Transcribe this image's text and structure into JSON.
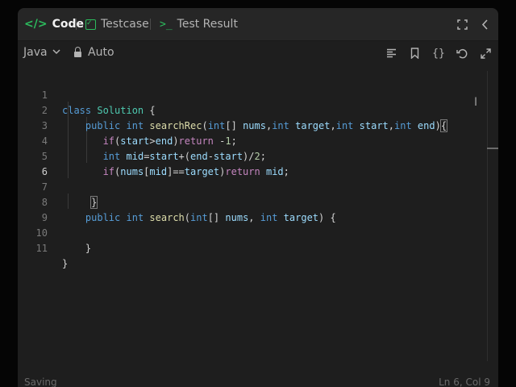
{
  "tabs": {
    "code": "Code",
    "testcase": "Testcase",
    "test_result": "Test Result"
  },
  "toolbar": {
    "language": "Java",
    "mode": "Auto"
  },
  "editor": {
    "line_numbers": [
      "1",
      "2",
      "3",
      "4",
      "5",
      "6",
      "7",
      "8",
      "9",
      "10",
      "11"
    ],
    "active_line": "6"
  },
  "status": {
    "left": "Saving",
    "right": "Ln 6, Col 9"
  },
  "icons": {
    "code_tab": "code-brackets-icon",
    "testcase_tab": "checkbox-icon",
    "result_tab": "terminal-icon",
    "fullscreen": "expand-icon",
    "collapse": "chevron-left-icon",
    "format": "align-left-icon",
    "bookmark": "bookmark-icon",
    "braces": "braces-icon",
    "reset": "undo-icon",
    "expand": "diagonal-expand-icon"
  },
  "colors": {
    "accent": "#2cbb5d",
    "keyword": "#569cd6",
    "control": "#c586c0",
    "function": "#dcdcaa",
    "class": "#4ec9b0",
    "variable": "#9cdcfe",
    "number": "#b5cea8"
  }
}
